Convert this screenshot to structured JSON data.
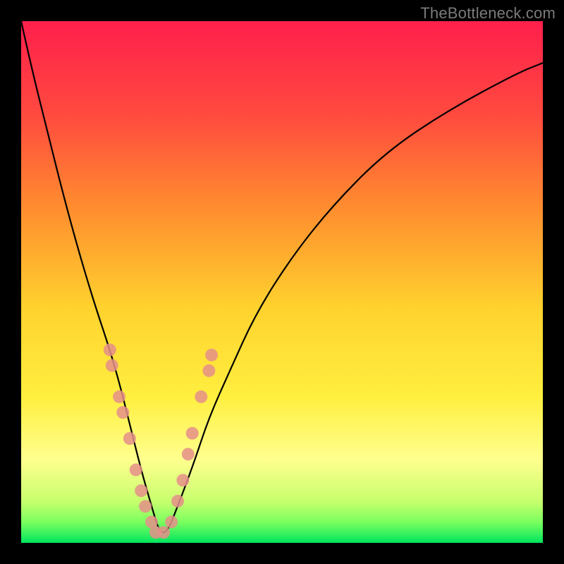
{
  "watermark": "TheBottleneck.com",
  "chart_data": {
    "type": "line",
    "title": "",
    "xlabel": "",
    "ylabel": "",
    "xlim": [
      0,
      100
    ],
    "ylim": [
      0,
      100
    ],
    "background": {
      "description": "vertical gradient indicating bottleneck severity; red at top (high), green at bottom (low)",
      "stops": [
        {
          "offset": 0,
          "color": "#ff1f4c"
        },
        {
          "offset": 18,
          "color": "#ff4a3f"
        },
        {
          "offset": 35,
          "color": "#ff8a2f"
        },
        {
          "offset": 55,
          "color": "#ffd22e"
        },
        {
          "offset": 72,
          "color": "#ffef3f"
        },
        {
          "offset": 84,
          "color": "#ffff8e"
        },
        {
          "offset": 92,
          "color": "#c8ff6e"
        },
        {
          "offset": 96,
          "color": "#7bff5f"
        },
        {
          "offset": 100,
          "color": "#00e55d"
        }
      ]
    },
    "series": [
      {
        "name": "bottleneck-curve",
        "stroke": "#000000",
        "stroke_width": 2.2,
        "x": [
          0,
          2,
          5,
          8,
          11,
          14,
          17,
          19,
          21,
          23,
          25,
          26.5,
          28,
          30,
          33,
          36,
          40,
          45,
          52,
          60,
          70,
          82,
          95,
          100
        ],
        "y_pct": [
          100,
          91,
          79,
          67,
          56,
          46,
          37,
          30,
          22,
          14,
          7,
          2,
          2,
          7,
          15,
          24,
          33,
          44,
          55,
          65,
          75,
          83,
          90,
          92
        ]
      }
    ],
    "markers": {
      "name": "data-points",
      "color": "#e58f8a",
      "opacity": 0.85,
      "r": 9,
      "points": [
        {
          "x": 17.0,
          "y_pct": 37
        },
        {
          "x": 17.4,
          "y_pct": 34
        },
        {
          "x": 18.8,
          "y_pct": 28
        },
        {
          "x": 19.5,
          "y_pct": 25
        },
        {
          "x": 20.8,
          "y_pct": 20
        },
        {
          "x": 22.0,
          "y_pct": 14
        },
        {
          "x": 23.0,
          "y_pct": 10
        },
        {
          "x": 23.8,
          "y_pct": 7
        },
        {
          "x": 25.0,
          "y_pct": 4
        },
        {
          "x": 25.8,
          "y_pct": 2
        },
        {
          "x": 27.3,
          "y_pct": 2
        },
        {
          "x": 28.8,
          "y_pct": 4
        },
        {
          "x": 30.0,
          "y_pct": 8
        },
        {
          "x": 31.0,
          "y_pct": 12
        },
        {
          "x": 32.0,
          "y_pct": 17
        },
        {
          "x": 32.8,
          "y_pct": 21
        },
        {
          "x": 34.5,
          "y_pct": 28
        },
        {
          "x": 36.0,
          "y_pct": 33
        },
        {
          "x": 36.5,
          "y_pct": 36
        }
      ]
    }
  }
}
